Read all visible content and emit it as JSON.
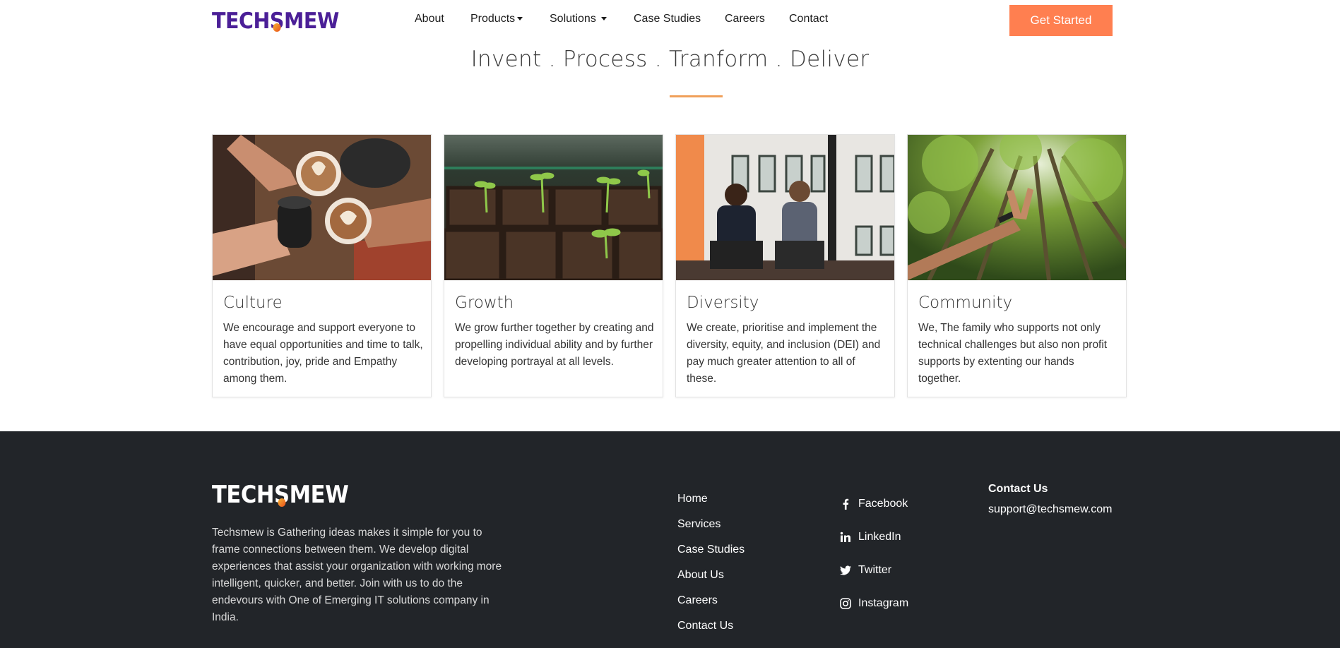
{
  "nav": {
    "logo_text": "TECHSMEW",
    "links": {
      "about": "About",
      "products": "Products",
      "solutions": "Solutions",
      "case_studies": "Case Studies",
      "careers": "Careers",
      "contact": "Contact"
    },
    "cta": "Get Started"
  },
  "hero": {
    "tagline": "Invent . Process . Tranform . Deliver"
  },
  "cards": [
    {
      "title": "Culture",
      "text": "We encourage and support everyone to have equal opportunities and time to talk, contribution, joy, pride and Empathy among them."
    },
    {
      "title": "Growth",
      "text": "We grow further together by creating and propelling individual ability and by further developing portrayal at all levels."
    },
    {
      "title": "Diversity",
      "text": "We create, prioritise and implement the diversity, equity, and inclusion (DEI) and pay much greater attention to all of these."
    },
    {
      "title": "Community",
      "text": "We, The family who supports not only technical challenges but also non profit supports by extenting our hands together."
    }
  ],
  "footer": {
    "logo_text": "TECHSMEW",
    "description": "Techsmew is Gathering ideas makes it simple for you to frame connections between them. We develop digital experiences that assist your organization with working more intelligent, quicker, and better. Join with us to do the endevours with One of Emerging IT solutions company in India.",
    "links": [
      "Home",
      "Services",
      "Case Studies",
      "About Us",
      "Careers",
      "Contact Us"
    ],
    "social": [
      {
        "label": "Facebook",
        "icon": "facebook-icon"
      },
      {
        "label": "LinkedIn",
        "icon": "linkedin-icon"
      },
      {
        "label": "Twitter",
        "icon": "twitter-icon"
      },
      {
        "label": "Instagram",
        "icon": "instagram-icon"
      }
    ],
    "contact_title": "Contact Us",
    "contact_email": "support@techsmew.com"
  },
  "colors": {
    "brand_purple": "#4b1f97",
    "cta_orange": "#ff7f50",
    "accent_underline": "#f0a05a",
    "footer_bg": "#222529"
  }
}
